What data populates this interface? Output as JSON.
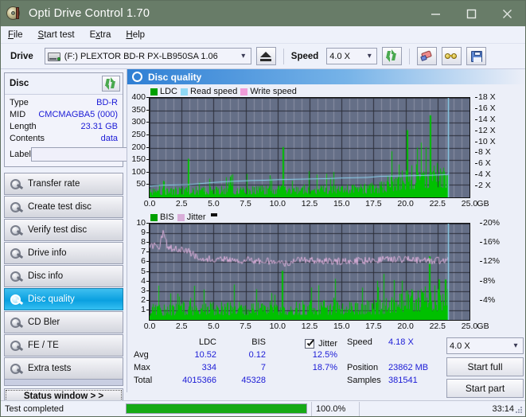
{
  "window": {
    "title": "Opti Drive Control 1.70",
    "icon": "disc-icon",
    "minimize": "–",
    "maximize": "□",
    "close": "✕",
    "titlebar_color": "#687c68"
  },
  "menu": {
    "items": [
      {
        "label": "File",
        "accel": "F"
      },
      {
        "label": "Start test",
        "accel": "S"
      },
      {
        "label": "Extra",
        "accel": "x"
      },
      {
        "label": "Help",
        "accel": "H"
      }
    ]
  },
  "toolbar": {
    "drive_label": "Drive",
    "drive_value": "(F:)   PLEXTOR BD-R  PX-LB950SA 1.06",
    "eject_title": "eject-button",
    "speed_label": "Speed",
    "speed_value": "4.0 X",
    "refresh_icon": "refresh-icon",
    "erase_icon": "eraser-icon",
    "glasses_icon": "glasses-icon",
    "save_icon": "floppy-save-icon"
  },
  "disc_panel": {
    "title": "Disc",
    "refresh_icon": "refresh-icon",
    "rows": [
      {
        "key": "Type",
        "value": "BD-R"
      },
      {
        "key": "MID",
        "value": "CMCMAGBA5 (000)"
      },
      {
        "key": "Length",
        "value": "23.31 GB"
      },
      {
        "key": "Contents",
        "value": "data"
      }
    ],
    "label_key": "Label",
    "label_value": "",
    "label_placeholder": "",
    "disc_button_icon": "cd-icon"
  },
  "sidebar": {
    "items": [
      {
        "label": "Transfer rate",
        "active": false
      },
      {
        "label": "Create test disc",
        "active": false
      },
      {
        "label": "Verify test disc",
        "active": false
      },
      {
        "label": "Drive info",
        "active": false
      },
      {
        "label": "Disc info",
        "active": false
      },
      {
        "label": "Disc quality",
        "active": true
      },
      {
        "label": "CD Bler",
        "active": false
      },
      {
        "label": "FE / TE",
        "active": false
      },
      {
        "label": "Extra tests",
        "active": false
      }
    ],
    "status_window": "Status window > >"
  },
  "panel": {
    "title": "Disc quality",
    "icon": "disc-quality-icon"
  },
  "stats": {
    "col_ldc": "LDC",
    "col_bis": "BIS",
    "jitter_label": "Jitter",
    "jitter_checked": true,
    "rows": [
      {
        "name": "Avg",
        "ldc": "10.52",
        "bis": "0.12",
        "jitter": "12.5%"
      },
      {
        "name": "Max",
        "ldc": "334",
        "bis": "7",
        "jitter": "18.7%"
      },
      {
        "name": "Total",
        "ldc": "4015366",
        "bis": "45328",
        "jitter": ""
      }
    ],
    "speed_key": "Speed",
    "speed_value": "4.18 X",
    "position_key": "Position",
    "position_value": "23862 MB",
    "samples_key": "Samples",
    "samples_value": "381541",
    "speed_select": "4.0 X",
    "start_full": "Start full",
    "start_part": "Start part"
  },
  "statusbar": {
    "message": "Test completed",
    "percent_text": "100.0%",
    "percent_value": 100,
    "elapsed": "33:14",
    "progress_color": "#16aa16"
  },
  "colors": {
    "ldc": "#00c000",
    "bis": "#00c000",
    "read_speed": "#8fd8f4",
    "write_speed": "#f09cd8",
    "jitter": "#d9aed9",
    "plot_bg": "#656f87",
    "grid": "#8a90a5",
    "accent": "#1b1bd6"
  },
  "chart_data": [
    {
      "type": "area",
      "name": "ldc-chart",
      "title": "",
      "xlabel": "GB",
      "ylabel": "LDC",
      "legend": [
        {
          "label": "LDC",
          "color": "#00a000"
        },
        {
          "label": "Read speed",
          "color": "#8fd8f4"
        },
        {
          "label": "Write speed",
          "color": "#f09cd8"
        }
      ],
      "legend_position": "top-left",
      "grid": true,
      "xlim": [
        0,
        25
      ],
      "xticks": [
        "0.0",
        "2.5",
        "5.0",
        "7.5",
        "10.0",
        "12.5",
        "15.0",
        "17.5",
        "20.0",
        "22.5",
        "25.0"
      ],
      "xtick_values": [
        0,
        2.5,
        5,
        7.5,
        10,
        12.5,
        15,
        17.5,
        20,
        22.5,
        25
      ],
      "xaxis_unit": "GB",
      "ylim": [
        0,
        400
      ],
      "yticks": [
        50,
        100,
        150,
        200,
        250,
        300,
        350,
        400
      ],
      "y2lim": [
        0,
        18
      ],
      "y2ticks": [
        "2 X",
        "4 X",
        "6 X",
        "8 X",
        "10 X",
        "12 X",
        "14 X",
        "16 X",
        "18 X"
      ],
      "y2tick_values": [
        2,
        4,
        6,
        8,
        10,
        12,
        14,
        16,
        18
      ],
      "data_end_x": 23.3,
      "series": [
        {
          "name": "LDC",
          "color": "#00c000",
          "style": "bars",
          "note": "dense error bars, baseline ~10-40, rising after 19 GB; spikes at 3.0 (155), 10.4 (202), 20.1 (270), 21.9 (330)",
          "baseline_profile": [
            [
              0.0,
              20
            ],
            [
              1.0,
              22
            ],
            [
              2.0,
              24
            ],
            [
              3.0,
              26
            ],
            [
              4.0,
              25
            ],
            [
              5.0,
              26
            ],
            [
              6.0,
              27
            ],
            [
              7.0,
              26
            ],
            [
              8.0,
              28
            ],
            [
              9.0,
              27
            ],
            [
              10.0,
              29
            ],
            [
              11.0,
              28
            ],
            [
              12.0,
              30
            ],
            [
              13.0,
              29
            ],
            [
              14.0,
              31
            ],
            [
              15.0,
              30
            ],
            [
              16.0,
              32
            ],
            [
              17.0,
              33
            ],
            [
              18.0,
              38
            ],
            [
              19.0,
              55
            ],
            [
              20.0,
              70
            ],
            [
              21.0,
              78
            ],
            [
              22.0,
              82
            ],
            [
              23.0,
              85
            ],
            [
              23.3,
              86
            ]
          ],
          "spikes": [
            [
              3.0,
              155
            ],
            [
              10.4,
              202
            ],
            [
              20.1,
              270
            ],
            [
              21.9,
              330
            ]
          ]
        },
        {
          "name": "Read speed",
          "color": "#8fd8f4",
          "style": "line",
          "axis": "right",
          "points": [
            [
              0.0,
              2.0
            ],
            [
              0.4,
              2.1
            ],
            [
              1.0,
              2.2
            ],
            [
              2.0,
              2.25
            ],
            [
              3.0,
              2.3
            ],
            [
              4.0,
              2.5
            ],
            [
              5.0,
              2.7
            ],
            [
              6.0,
              2.85
            ],
            [
              7.0,
              2.95
            ],
            [
              8.0,
              3.05
            ],
            [
              9.0,
              3.1
            ],
            [
              10.0,
              3.2
            ],
            [
              11.0,
              3.25
            ],
            [
              12.0,
              3.3
            ],
            [
              13.0,
              3.35
            ],
            [
              14.0,
              3.4
            ],
            [
              15.0,
              3.5
            ],
            [
              16.0,
              3.55
            ],
            [
              17.0,
              3.6
            ],
            [
              18.0,
              3.8
            ],
            [
              19.0,
              3.85
            ],
            [
              20.0,
              3.9
            ],
            [
              21.0,
              3.95
            ],
            [
              22.0,
              4.0
            ],
            [
              23.0,
              4.1
            ],
            [
              23.3,
              4.18
            ]
          ]
        },
        {
          "name": "Write speed",
          "color": "#f09cd8",
          "style": "line",
          "points": []
        },
        {
          "name": "end-marker",
          "color": "#8fd8f4",
          "style": "vline",
          "x": 23.35
        }
      ]
    },
    {
      "type": "area",
      "name": "bis-jitter-chart",
      "title": "",
      "xlabel": "GB",
      "ylabel": "BIS",
      "legend": [
        {
          "label": "BIS",
          "color": "#00a000"
        },
        {
          "label": "Jitter",
          "color": "#d9aed9"
        }
      ],
      "legend_position": "top-left",
      "grid": true,
      "xlim": [
        0,
        25
      ],
      "xticks": [
        "0.0",
        "2.5",
        "5.0",
        "7.5",
        "10.0",
        "12.5",
        "15.0",
        "17.5",
        "20.0",
        "22.5",
        "25.0"
      ],
      "xtick_values": [
        0,
        2.5,
        5,
        7.5,
        10,
        12.5,
        15,
        17.5,
        20,
        22.5,
        25
      ],
      "xaxis_unit": "GB",
      "ylim": [
        0,
        10
      ],
      "yticks": [
        1,
        2,
        3,
        4,
        5,
        6,
        7,
        8,
        9,
        10
      ],
      "y2lim": [
        0,
        20
      ],
      "y2ticks": [
        "4%",
        "8%",
        "12%",
        "16%",
        "20%"
      ],
      "y2tick_values": [
        4,
        8,
        12,
        16,
        20
      ],
      "data_end_x": 23.3,
      "series": [
        {
          "name": "BIS",
          "color": "#00c000",
          "style": "bars",
          "note": "dense bars baseline ~1, frequent spikes to 2-3, higher density after 19 GB",
          "baseline_profile": [
            [
              0.0,
              1.0
            ],
            [
              2.0,
              1.05
            ],
            [
              4.0,
              1.05
            ],
            [
              6.0,
              1.1
            ],
            [
              8.0,
              1.1
            ],
            [
              10.0,
              1.15
            ],
            [
              12.0,
              1.2
            ],
            [
              14.0,
              1.2
            ],
            [
              16.0,
              1.25
            ],
            [
              18.0,
              1.3
            ],
            [
              19.0,
              1.6
            ],
            [
              20.0,
              1.9
            ],
            [
              21.0,
              2.0
            ],
            [
              22.0,
              2.1
            ],
            [
              23.0,
              2.1
            ],
            [
              23.3,
              2.1
            ]
          ],
          "spikes": [
            [
              10.35,
              5.1
            ],
            [
              21.85,
              6.6
            ],
            [
              22.6,
              4.2
            ],
            [
              23.1,
              4.2
            ]
          ]
        },
        {
          "name": "Jitter",
          "color": "#d9aed9",
          "style": "line",
          "axis": "right",
          "unit": "%",
          "points": [
            [
              0.0,
              15.0
            ],
            [
              0.3,
              15.6
            ],
            [
              0.8,
              15.2
            ],
            [
              1.1,
              18.7
            ],
            [
              1.4,
              15.0
            ],
            [
              2.0,
              14.8
            ],
            [
              2.5,
              14.6
            ],
            [
              3.0,
              14.4
            ],
            [
              3.5,
              13.4
            ],
            [
              4.0,
              13.0
            ],
            [
              5.0,
              12.6
            ],
            [
              6.0,
              12.6
            ],
            [
              7.0,
              12.4
            ],
            [
              8.0,
              12.4
            ],
            [
              9.0,
              12.2
            ],
            [
              10.0,
              12.2
            ],
            [
              10.5,
              11.6
            ],
            [
              11.0,
              12.0
            ],
            [
              12.0,
              12.6
            ],
            [
              13.0,
              12.4
            ],
            [
              14.0,
              12.2
            ],
            [
              15.0,
              12.2
            ],
            [
              16.0,
              12.2
            ],
            [
              17.0,
              12.3
            ],
            [
              18.0,
              12.5
            ],
            [
              19.0,
              12.6
            ],
            [
              20.0,
              12.6
            ],
            [
              21.0,
              12.4
            ],
            [
              22.0,
              12.3
            ],
            [
              23.0,
              12.4
            ],
            [
              23.3,
              12.5
            ]
          ]
        },
        {
          "name": "end-marker",
          "color": "#8fd8f4",
          "style": "vline",
          "x": 23.35
        }
      ]
    }
  ]
}
